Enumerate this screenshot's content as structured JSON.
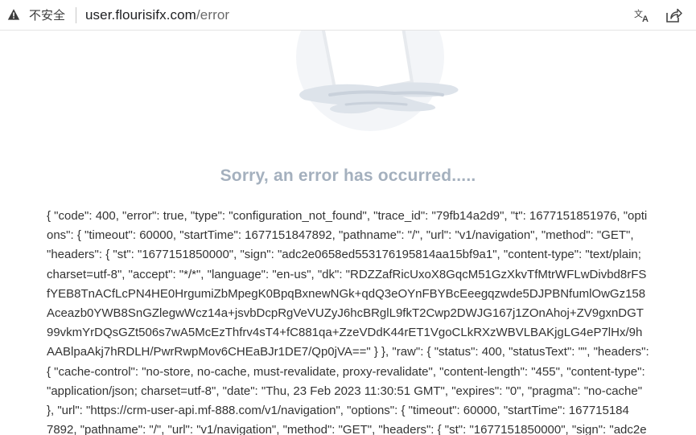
{
  "browser": {
    "security_label": "不安全",
    "url_host": "user.flourisifx.com",
    "url_path": "/error",
    "icons": {
      "security": "warning-triangle-icon",
      "translate": "translate-icon",
      "share": "share-icon"
    }
  },
  "page": {
    "error_title": "Sorry, an error has occurred.....",
    "json_lines": [
      "{ \"code\": 400, \"error\": true, \"type\": \"configuration_not_found\", \"trace_id\": \"79fb14a2d9\", \"t\": 1677151851976, \"opti",
      "ons\": { \"timeout\": 60000, \"startTime\": 1677151847892, \"pathname\": \"/\", \"url\": \"v1/navigation\", \"method\": \"GET\", ",
      "\"headers\": { \"st\": \"1677151850000\", \"sign\": \"adc2e0658ed553176195814aa15bf9a1\", \"content-type\": \"text/plain;",
      "charset=utf-8\", \"accept\": \"*/*\", \"language\": \"en-us\", \"dk\": \"RDZZafRicUxoX8GqcM51GzXkvTfMtrWFLwDivbd8rFS",
      "fYEB8TnACfLcPN4HE0HrgumiZbMpegK0BpqBxnewNGk+qdQ3eOYnFBYBcEeegqzwde5DJPBNfumlOwGz158",
      "Aceazb0YWB8SnGZlegwWcz14a+jsvbDcpRgVeVUZyJ6hcBRglL9fkT2Cwp2DWJG167j1ZOnAhoj+ZV9gxnDGT",
      "99vkmYrDQsGZt506s7wA5McEzThfrv4sT4+fC881qa+ZzeVDdK44rET1VgoCLkRXzWBVLBAKjgLG4eP7lHx/9h",
      "AABlpaAkj7hRDLH/PwrRwpMov6CHEaBJr1DE7/Qp0jVA==\" } }, \"raw\": { \"status\": 400, \"statusText\": \"\", \"headers\":",
      "{ \"cache-control\": \"no-store, no-cache, must-revalidate, proxy-revalidate\", \"content-length\": \"455\", \"content-type\":",
      "\"application/json; charset=utf-8\", \"date\": \"Thu, 23 Feb 2023 11:30:51 GMT\", \"expires\": \"0\", \"pragma\": \"no-cache\"",
      "}, \"url\": \"https://crm-user-api.mf-888.com/v1/navigation\", \"options\": { \"timeout\": 60000, \"startTime\": 167715184",
      "7892, \"pathname\": \"/\", \"url\": \"v1/navigation\", \"method\": \"GET\", \"headers\": { \"st\": \"1677151850000\", \"sign\": \"adc2e"
    ]
  }
}
